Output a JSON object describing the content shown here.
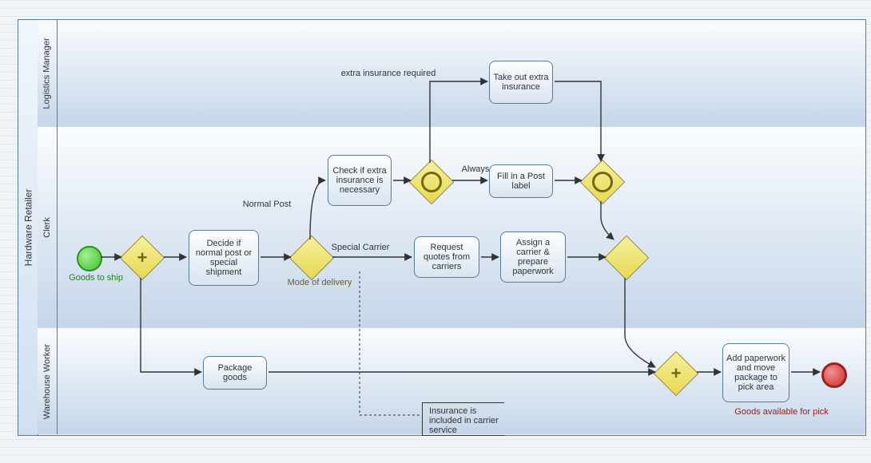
{
  "pool": {
    "title": "Hardware Retailer"
  },
  "lanes": {
    "l1": "Logistics  Manager",
    "l2": "Clerk",
    "l3": "Warehouse Worker"
  },
  "tasks": {
    "extra_insurance": "Take out extra insurance",
    "check_insurance": "Check if extra insurance is necessary",
    "fill_post_label": "Fill in a Post label",
    "decide": "Decide if normal post or special shipment",
    "request_quotes": "Request quotes from carriers",
    "assign_carrier": "Assign a carrier & prepare paperwork",
    "package_goods": "Package goods",
    "add_paperwork": "Add paperwork and move package to pick area"
  },
  "labels": {
    "goods_to_ship": "Goods  to ship",
    "normal_post": "Normal Post",
    "special_carrier": "Special Carrier",
    "mode_of_delivery": "Mode of delivery",
    "extra_required": "extra insurance required",
    "always": "Always",
    "goods_available": "Goods available  for pick"
  },
  "annotation": {
    "insurance_included": "Insurance is included in carrier service"
  },
  "chart_data": {
    "type": "bpmn",
    "pool": "Hardware Retailer",
    "lanes": [
      "Logistics Manager",
      "Clerk",
      "Warehouse Worker"
    ],
    "nodes": [
      {
        "id": "start",
        "type": "start-event",
        "lane": "Clerk",
        "label": "Goods to ship"
      },
      {
        "id": "g1",
        "type": "parallel-gateway",
        "lane": "Clerk"
      },
      {
        "id": "decide",
        "type": "task",
        "lane": "Clerk",
        "label": "Decide if normal post or special shipment"
      },
      {
        "id": "g2",
        "type": "exclusive-gateway",
        "lane": "Clerk",
        "label": "Mode of delivery"
      },
      {
        "id": "check",
        "type": "task",
        "lane": "Clerk",
        "label": "Check if extra insurance is necessary"
      },
      {
        "id": "g3",
        "type": "inclusive-gateway",
        "lane": "Clerk"
      },
      {
        "id": "extra",
        "type": "task",
        "lane": "Logistics Manager",
        "label": "Take out extra insurance"
      },
      {
        "id": "fill",
        "type": "task",
        "lane": "Clerk",
        "label": "Fill in a Post label"
      },
      {
        "id": "g4",
        "type": "inclusive-gateway",
        "lane": "Clerk"
      },
      {
        "id": "quotes",
        "type": "task",
        "lane": "Clerk",
        "label": "Request quotes from carriers"
      },
      {
        "id": "assign",
        "type": "task",
        "lane": "Clerk",
        "label": "Assign a carrier & prepare paperwork"
      },
      {
        "id": "g5",
        "type": "exclusive-gateway",
        "lane": "Clerk"
      },
      {
        "id": "package",
        "type": "task",
        "lane": "Warehouse Worker",
        "label": "Package goods"
      },
      {
        "id": "g6",
        "type": "parallel-gateway",
        "lane": "Warehouse Worker"
      },
      {
        "id": "paperwork",
        "type": "task",
        "lane": "Warehouse Worker",
        "label": "Add paperwork and move package to pick area"
      },
      {
        "id": "end",
        "type": "end-event",
        "lane": "Warehouse Worker",
        "label": "Goods available for pick"
      }
    ],
    "flows": [
      {
        "from": "start",
        "to": "g1"
      },
      {
        "from": "g1",
        "to": "decide"
      },
      {
        "from": "g1",
        "to": "package"
      },
      {
        "from": "decide",
        "to": "g2"
      },
      {
        "from": "g2",
        "to": "check",
        "label": "Normal Post"
      },
      {
        "from": "g2",
        "to": "quotes",
        "label": "Special Carrier"
      },
      {
        "from": "check",
        "to": "g3"
      },
      {
        "from": "g3",
        "to": "extra",
        "label": "extra insurance required"
      },
      {
        "from": "g3",
        "to": "fill",
        "label": "Always"
      },
      {
        "from": "extra",
        "to": "g4"
      },
      {
        "from": "fill",
        "to": "g4"
      },
      {
        "from": "g4",
        "to": "g5"
      },
      {
        "from": "quotes",
        "to": "assign"
      },
      {
        "from": "assign",
        "to": "g5"
      },
      {
        "from": "g5",
        "to": "g6"
      },
      {
        "from": "package",
        "to": "g6"
      },
      {
        "from": "g6",
        "to": "paperwork"
      },
      {
        "from": "paperwork",
        "to": "end"
      }
    ],
    "annotations": [
      {
        "text": "Insurance is included in carrier service",
        "attached_to": "g2"
      }
    ]
  }
}
